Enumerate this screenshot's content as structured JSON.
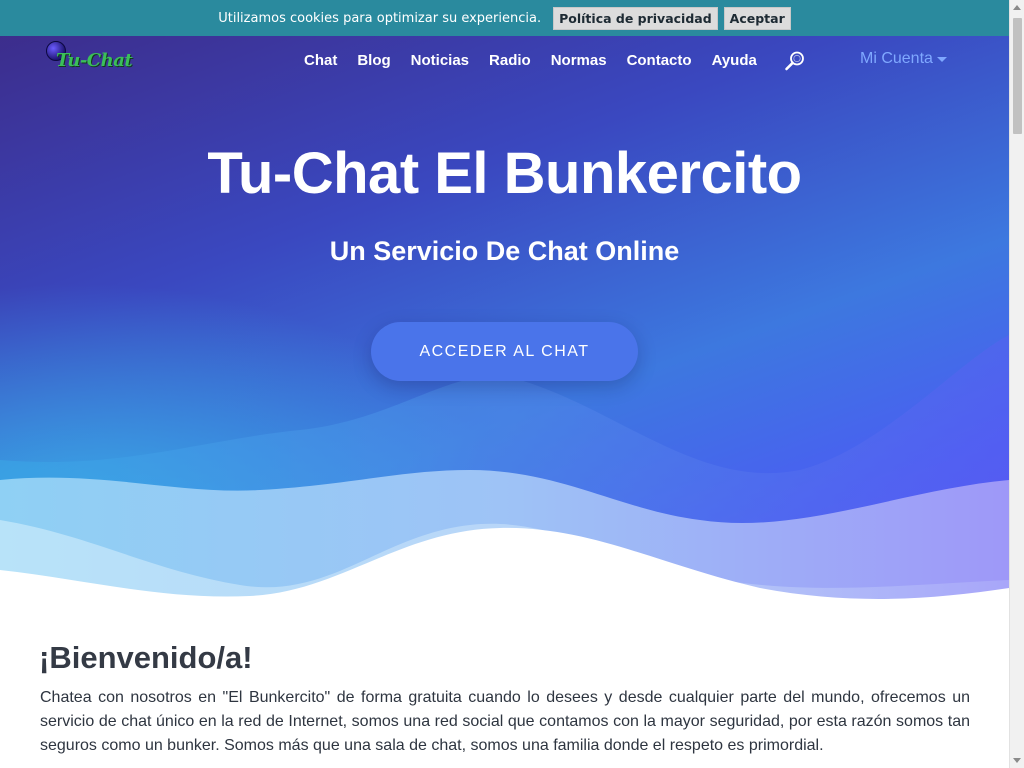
{
  "cookie_banner": {
    "message": "Utilizamos cookies para optimizar su experiencia.",
    "privacy_label": "Política de privacidad",
    "accept_label": "Aceptar"
  },
  "navbar": {
    "logo_text": "Tu-Chat",
    "links": [
      "Chat",
      "Blog",
      "Noticias",
      "Radio",
      "Normas",
      "Contacto",
      "Ayuda"
    ],
    "account_label": "Mi Cuenta",
    "search_icon": "search-icon"
  },
  "hero": {
    "title": "Tu-Chat El Bunkercito",
    "subtitle": "Un Servicio De Chat Online",
    "cta_label": "ACCEDER AL CHAT"
  },
  "content": {
    "heading": "¡Bienvenido/a!",
    "paragraph": "Chatea con nosotros en \"El Bunkercito\" de forma gratuita cuando lo desees y desde cualquier parte del mundo, ofrecemos un servicio de chat único en la red de Internet, somos una red social que contamos con la mayor seguridad, por esta razón somos tan seguros como un bunker. Somos más que una sala de chat, somos una familia donde el respeto es primordial."
  },
  "colors": {
    "cookie_bar": "#2a8a9e",
    "account_link": "#7fa8ff",
    "cta_button": "#4a74ea"
  }
}
